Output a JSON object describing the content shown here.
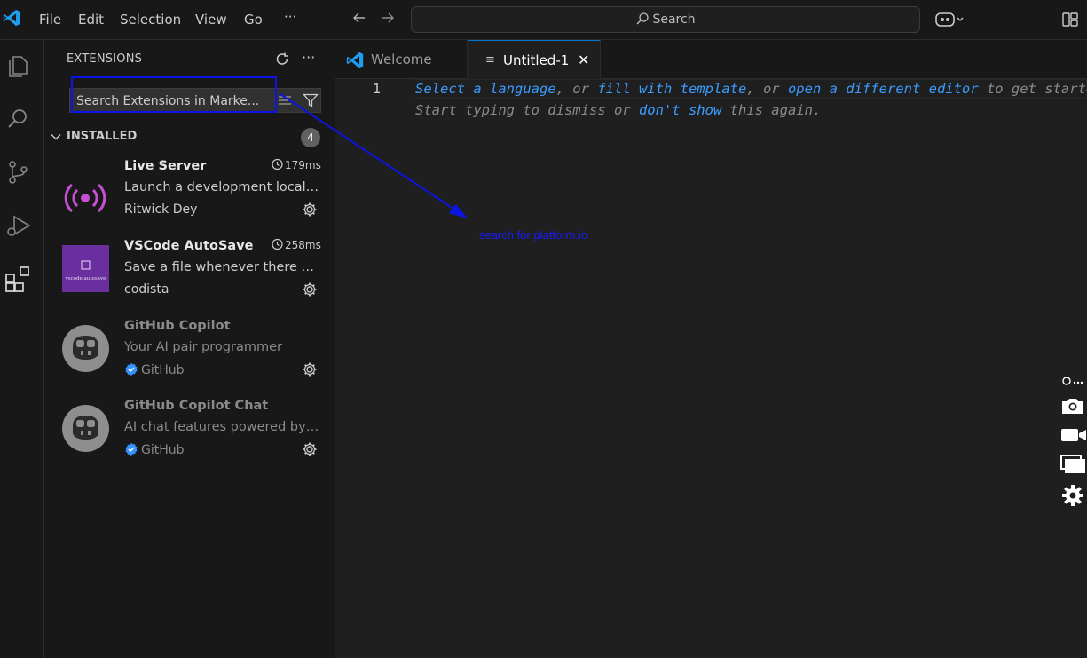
{
  "menu": {
    "file": "File",
    "edit": "Edit",
    "selection": "Selection",
    "view": "View",
    "go": "Go",
    "more": "···"
  },
  "title_search": {
    "text": "Search"
  },
  "sidebar": {
    "title": "EXTENSIONS",
    "more": "···",
    "search_placeholder": "Search Extensions in Marke...",
    "section_label": "INSTALLED",
    "installed_count": "4",
    "extensions": [
      {
        "name": "Live Server",
        "time": "179ms",
        "description": "Launch a development local Server with live reload feature for static & dynamic pages",
        "publisher": "Ritwick Dey",
        "icon": "broadcast-icon"
      },
      {
        "name": "VSCode AutoSave",
        "time": "258ms",
        "description": "Save a file whenever there are changes",
        "publisher": "codista",
        "icon": "autosave-icon",
        "icon_text": "vscode autosave"
      },
      {
        "name": "GitHub Copilot",
        "description": "Your AI pair programmer",
        "publisher": "GitHub",
        "icon": "copilot-icon"
      },
      {
        "name": "GitHub Copilot Chat",
        "description": "AI chat features powered by Copilot",
        "publisher": "GitHub",
        "icon": "copilot-icon"
      }
    ]
  },
  "tabs": [
    {
      "label": "Welcome",
      "active": false
    },
    {
      "label": "Untitled-1",
      "active": true,
      "close": "✕"
    }
  ],
  "editor": {
    "line_number": "1",
    "hint_line1": {
      "part1": "Select a language",
      "sep1": ", or ",
      "part2": "fill with template",
      "sep2": ", or ",
      "part3": "open a different editor",
      "tail": " to get started."
    },
    "hint_line2": {
      "prefix": "Start typing to dismiss or ",
      "link": "don't show",
      "suffix": " this again."
    }
  },
  "annotation": {
    "text": "search for platform.io",
    "color": "#0b16e6"
  },
  "colors": {
    "accent": "#0078d4",
    "link": "#3b9cff",
    "background": "#1f1f1f",
    "sidebar": "#181818"
  }
}
